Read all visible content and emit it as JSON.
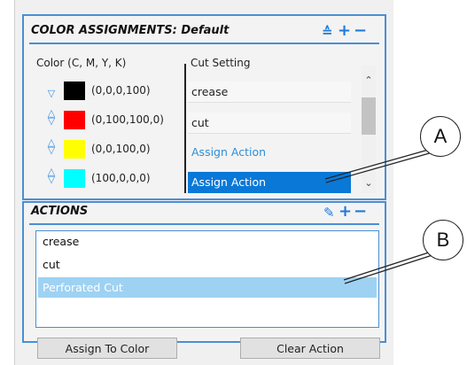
{
  "color_assignments": {
    "title": "COLOR ASSIGNMENTS: Default",
    "toolbar": {
      "sort_icon": "≙",
      "add_icon": "+",
      "remove_icon": "−"
    },
    "col_color": "Color (C, M, Y, K)",
    "col_cut": "Cut Setting",
    "rows": [
      {
        "swatch": "#000000",
        "cmyk": "(0,0,0,100)",
        "cut": "crease",
        "arrows": "down"
      },
      {
        "swatch": "#ff0000",
        "cmyk": "(0,100,100,0)",
        "cut": "cut",
        "arrows": "updown"
      },
      {
        "swatch": "#ffff00",
        "cmyk": "(0,0,100,0)",
        "cut": "Assign Action",
        "arrows": "updown"
      },
      {
        "swatch": "#00ffff",
        "cmyk": "(100,0,0,0)",
        "cut": "Assign Action",
        "arrows": "updown"
      }
    ]
  },
  "actions": {
    "title": "ACTIONS",
    "toolbar": {
      "edit_icon": "✎",
      "add_icon": "+",
      "remove_icon": "−"
    },
    "items": [
      "crease",
      "cut",
      "Perforated Cut"
    ],
    "selected_index": 2,
    "assign_button": "Assign To Color",
    "clear_button": "Clear Action"
  },
  "callouts": {
    "a": "A",
    "b": "B"
  },
  "colors": {
    "accent": "#4a8fd4",
    "selection": "#0a78d7",
    "list_selection": "#9ed2f3",
    "link": "#2e8fd8"
  }
}
